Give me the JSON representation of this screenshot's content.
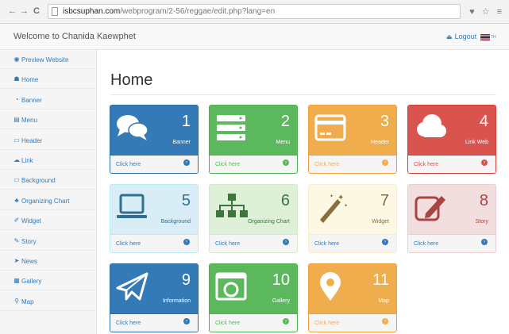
{
  "browser": {
    "back": "←",
    "forward": "→",
    "reload": "C",
    "url_host": "isbcsuphan.com",
    "url_path": "/webprogram/2-56/reggae/edit.php?lang=en",
    "right_icons": "♥ ☆ ≡"
  },
  "header": {
    "welcome": "Welcome to Chanida Kaewphet",
    "logout": "Logout",
    "lang_code": "TH"
  },
  "sidebar": {
    "items": [
      {
        "label": "Preview Website",
        "icon": "eye-icon",
        "glyph": "◉"
      },
      {
        "label": "Home",
        "icon": "dashboard-icon",
        "glyph": "☗"
      },
      {
        "label": "Banner",
        "icon": "comments-icon",
        "glyph": "◔"
      },
      {
        "label": "Menu",
        "icon": "menu-icon",
        "glyph": "▤"
      },
      {
        "label": "Header",
        "icon": "header-card-icon",
        "glyph": "▭"
      },
      {
        "label": "Link",
        "icon": "cloud-icon",
        "glyph": "☁"
      },
      {
        "label": "Background",
        "icon": "laptop-icon",
        "glyph": "▭"
      },
      {
        "label": "Organizing Chart",
        "icon": "sitemap-icon",
        "glyph": "♣"
      },
      {
        "label": "Widget",
        "icon": "magic-icon",
        "glyph": "✐"
      },
      {
        "label": "Story",
        "icon": "edit-icon",
        "glyph": "✎"
      },
      {
        "label": "News",
        "icon": "send-icon",
        "glyph": "➤"
      },
      {
        "label": "Gallery",
        "icon": "gallery-icon",
        "glyph": "▦"
      },
      {
        "label": "Map",
        "icon": "map-marker-icon",
        "glyph": "⚲"
      }
    ]
  },
  "main": {
    "title": "Home",
    "panels": [
      {
        "number": "1",
        "label": "Banner",
        "footer": "Click here",
        "icon": "comments-icon",
        "color": "#337ab7",
        "variant": "p-blue"
      },
      {
        "number": "2",
        "label": "Menu",
        "footer": "Click here",
        "icon": "menu-icon",
        "color": "#5cb85c",
        "variant": "p-green"
      },
      {
        "number": "3",
        "label": "Header",
        "footer": "Click here",
        "icon": "header-card-icon",
        "color": "#f0ad4e",
        "variant": "p-orange"
      },
      {
        "number": "4",
        "label": "Link Web",
        "footer": "Click here",
        "icon": "cloud-icon",
        "color": "#d9534f",
        "variant": "p-red"
      },
      {
        "number": "5",
        "label": "Background",
        "footer": "Click here",
        "icon": "laptop-icon",
        "color": "#31708f",
        "variant": "p-lblue"
      },
      {
        "number": "6",
        "label": "Organizing Chart",
        "footer": "Click here",
        "icon": "sitemap-icon",
        "color": "#3c763d",
        "variant": "p-lgreen"
      },
      {
        "number": "7",
        "label": "Widget",
        "footer": "Click here",
        "icon": "magic-wand-icon",
        "color": "#8a6d3b",
        "variant": "p-lyellow"
      },
      {
        "number": "8",
        "label": "Story",
        "footer": "Click here",
        "icon": "edit-icon",
        "color": "#a94442",
        "variant": "p-lred"
      },
      {
        "number": "9",
        "label": "Information",
        "footer": "Click here",
        "icon": "paper-plane-icon",
        "color": "#337ab7",
        "variant": "p-blue"
      },
      {
        "number": "10",
        "label": "Gallery",
        "footer": "Click here",
        "icon": "picture-icon",
        "color": "#5cb85c",
        "variant": "p-green"
      },
      {
        "number": "11",
        "label": "Map",
        "footer": "Click here",
        "icon": "map-marker-icon",
        "color": "#f0ad4e",
        "variant": "p-orange"
      }
    ]
  }
}
